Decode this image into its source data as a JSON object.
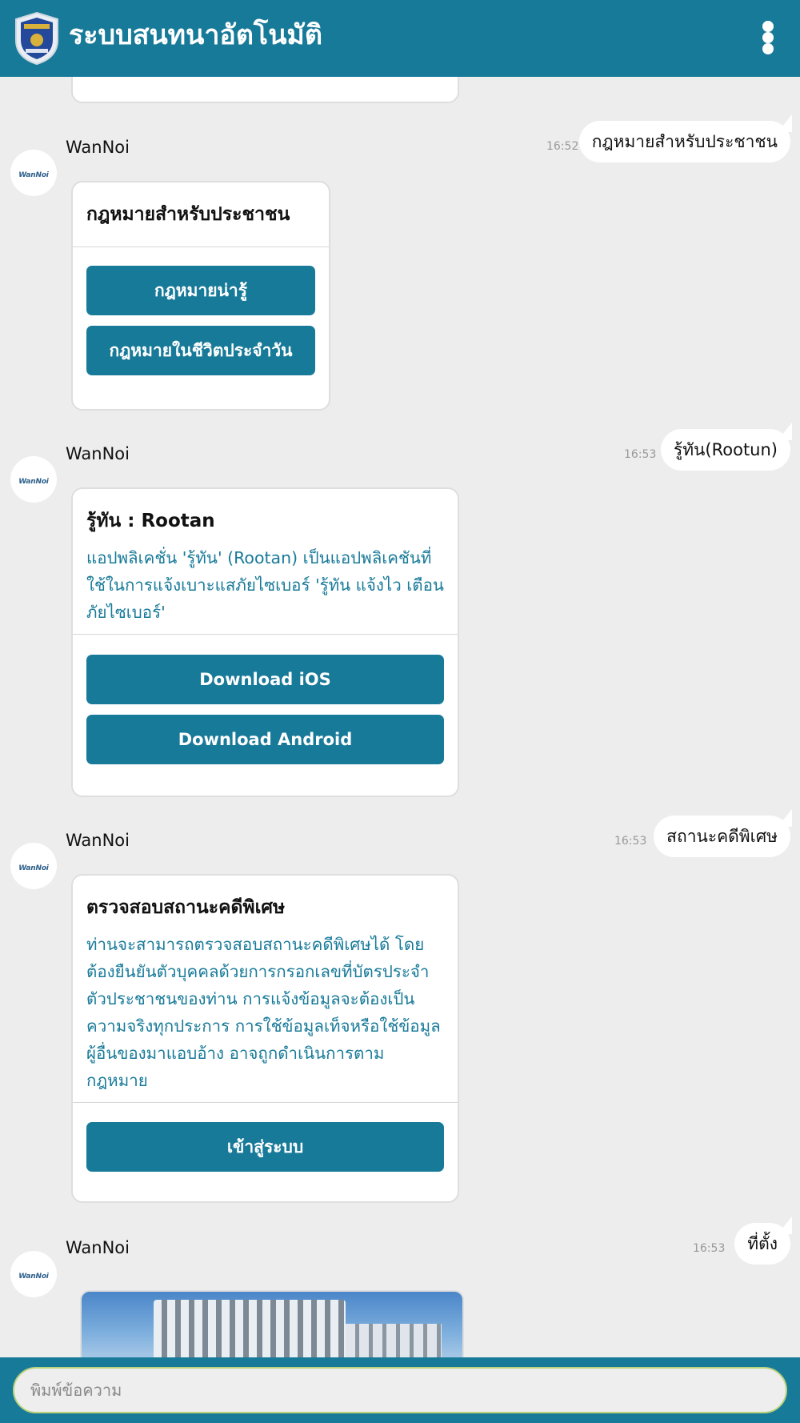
{
  "header": {
    "title": "ระบบสนทนาอัตโนมัติ",
    "logo_icon": "dsi-shield-logo",
    "menu_icon": "more-vertical-icon"
  },
  "colors": {
    "primary": "#187a99",
    "background": "#ededed",
    "card_text": "#187a99"
  },
  "bot": {
    "name": "WanNoi",
    "avatar_text": "WanNoi"
  },
  "messages": [
    {
      "user_text": "กฎหมายสำหรับประชาชน",
      "time": "16:52",
      "card": {
        "title": "กฎหมายสำหรับประชาชน",
        "buttons": [
          "กฎหมายน่ารู้",
          "กฎหมายในชีวิตประจำวัน"
        ]
      }
    },
    {
      "user_text": "รู้ทัน(Rootun)",
      "time": "16:53",
      "card": {
        "title": "รู้ทัน : Rootan",
        "text_lines": [
          "แอปพลิเคชั่น 'รู้ทัน' (Rootan) เป็นแอปพลิเคชันที่",
          "ใช้ในการแจ้งเบาะแสภัยไซเบอร์ 'รู้ทัน แจ้งไว เตือน",
          "ภัยไซเบอร์'"
        ],
        "buttons": [
          "Download iOS",
          "Download Android"
        ]
      }
    },
    {
      "user_text": "สถานะคดีพิเศษ",
      "time": "16:53",
      "card": {
        "title": "ตรวจสอบสถานะคดีพิเศษ",
        "text_lines": [
          "ท่านจะสามารถตรวจสอบสถานะคดีพิเศษได้ โดย",
          "ต้องยืนยันตัวบุคคลด้วยการกรอกเลขที่บัตรประจำ",
          "ตัวประชาชนของท่าน  การแจ้งข้อมูลจะต้องเป็น",
          "ความจริงทุกประการ การใช้ข้อมูลเท็จหรือใช้ข้อมูล",
          "ผู้อื่นของมาแอบอ้าง อาจถูกดำเนินการตาม",
          "กฎหมาย"
        ],
        "buttons": [
          "เข้าสู่ระบบ"
        ]
      }
    },
    {
      "user_text": "ที่ตั้ง",
      "time": "16:53"
    }
  ],
  "composer": {
    "placeholder": "พิมพ์ข้อความ"
  }
}
